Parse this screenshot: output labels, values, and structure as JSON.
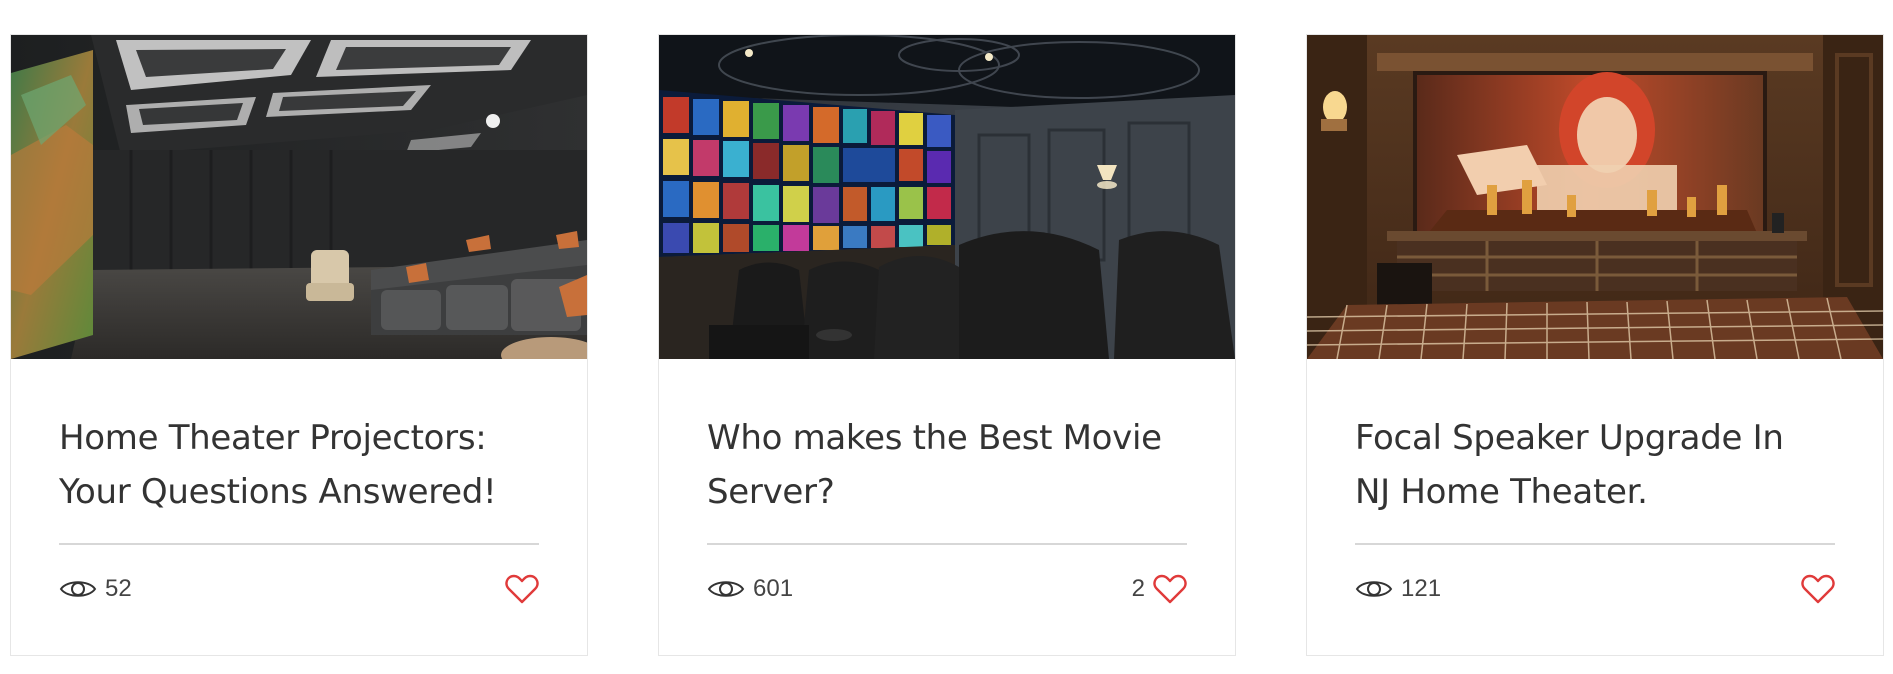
{
  "colors": {
    "heart": "#e03a3a",
    "divider": "#d7d7d7",
    "card_border": "#e6e6e6",
    "title_text": "#333333"
  },
  "icons": {
    "views": "eye-icon",
    "likes": "heart-outline-icon"
  },
  "cards": [
    {
      "image_subject": "dark home theater room with projector screen and grey sectional sofa",
      "title_line1": "Home Theater Projectors:",
      "title_line2": "Your Questions Answered!",
      "views": "52",
      "likes": ""
    },
    {
      "image_subject": "home theater with movie-poster grid on screen and black leather recliners",
      "title_line1": "Who makes the Best Movie",
      "title_line2": "Server?",
      "views": "601",
      "likes": "2"
    },
    {
      "image_subject": "wood-paneled home theater with red-haired woman playing chess on screen",
      "title_line1": "Focal Speaker Upgrade In",
      "title_line2": "NJ Home Theater.",
      "views": "121",
      "likes": ""
    }
  ]
}
